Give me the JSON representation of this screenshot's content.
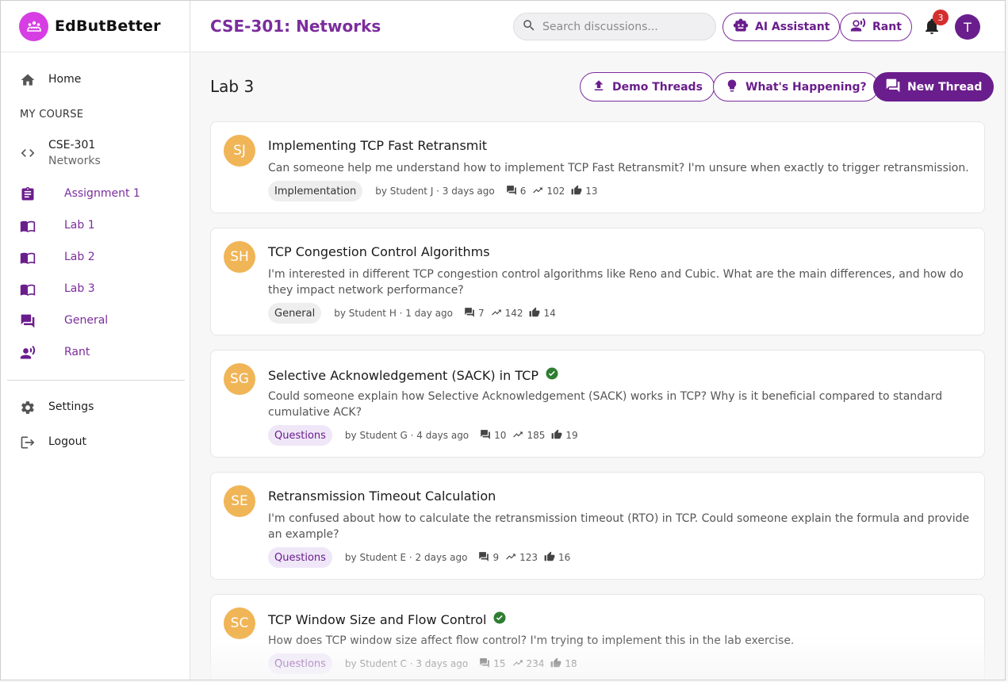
{
  "app": {
    "name": "EdButBetter"
  },
  "sidebar": {
    "home_label": "Home",
    "section_label": "MY COURSE",
    "course": {
      "code": "CSE-301",
      "name": "Networks"
    },
    "items": [
      {
        "label": "Assignment 1"
      },
      {
        "label": "Lab 1"
      },
      {
        "label": "Lab 2"
      },
      {
        "label": "Lab 3"
      },
      {
        "label": "General"
      },
      {
        "label": "Rant"
      }
    ],
    "settings_label": "Settings",
    "logout_label": "Logout"
  },
  "header": {
    "course_title": "CSE-301: Networks",
    "search_placeholder": "Search discussions...",
    "ai_label": "AI Assistant",
    "rant_label": "Rant",
    "notification_count": "3",
    "user_initial": "T"
  },
  "main": {
    "title": "Lab 3",
    "demo_label": "Demo Threads",
    "happening_label": "What's Happening?",
    "new_thread_label": "New Thread"
  },
  "threads": [
    {
      "initials": "SJ",
      "title": "Implementing TCP Fast Retransmit",
      "resolved": false,
      "body": "Can someone help me understand how to implement TCP Fast Retransmit? I'm unsure when exactly to trigger retransmission.",
      "tag": "Implementation",
      "byline": "by Student J · 3 days ago",
      "replies": "6",
      "views": "102",
      "likes": "13"
    },
    {
      "initials": "SH",
      "title": "TCP Congestion Control Algorithms",
      "resolved": false,
      "body": "I'm interested in different TCP congestion control algorithms like Reno and Cubic. What are the main differences, and how do they impact network performance?",
      "tag": "General",
      "byline": "by Student H · 1 day ago",
      "replies": "7",
      "views": "142",
      "likes": "14"
    },
    {
      "initials": "SG",
      "title": "Selective Acknowledgement (SACK) in TCP",
      "resolved": true,
      "body": "Could someone explain how Selective Acknowledgement (SACK) works in TCP? Why is it beneficial compared to standard cumulative ACK?",
      "tag": "Questions",
      "byline": "by Student G · 4 days ago",
      "replies": "10",
      "views": "185",
      "likes": "19"
    },
    {
      "initials": "SE",
      "title": "Retransmission Timeout Calculation",
      "resolved": false,
      "body": "I'm confused about how to calculate the retransmission timeout (RTO) in TCP. Could someone explain the formula and provide an example?",
      "tag": "Questions",
      "byline": "by Student E · 2 days ago",
      "replies": "9",
      "views": "123",
      "likes": "16"
    },
    {
      "initials": "SC",
      "title": "TCP Window Size and Flow Control",
      "resolved": true,
      "body": "How does TCP window size affect flow control? I'm trying to implement this in the lab exercise.",
      "tag": "Questions",
      "byline": "by Student C · 3 days ago",
      "replies": "15",
      "views": "234",
      "likes": "18"
    }
  ]
}
